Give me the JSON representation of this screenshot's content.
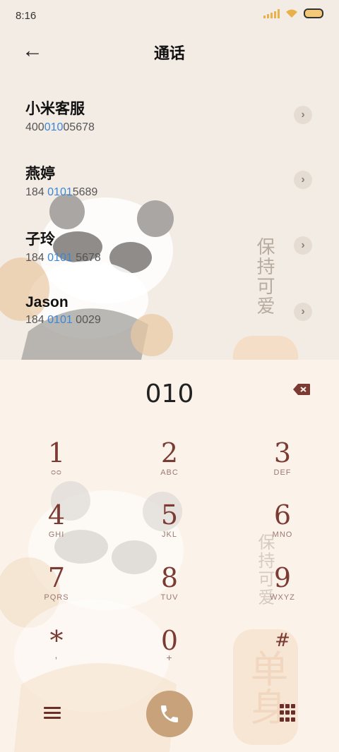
{
  "status": {
    "time": "8:16"
  },
  "header": {
    "title": "通话",
    "back_icon": "←"
  },
  "contacts": [
    {
      "name": "小米客服",
      "num_pre": "400",
      "num_hl": "010",
      "num_post": "05678"
    },
    {
      "name": "燕婷",
      "num_pre": "184 ",
      "num_hl": "0101",
      "num_post": "5689"
    },
    {
      "name": "子玲",
      "num_pre": "184 ",
      "num_hl": "0101",
      "num_post": " 5678"
    },
    {
      "name": "Jason",
      "num_pre": "184 ",
      "num_hl": "0101",
      "num_post": " 0029"
    }
  ],
  "decor": {
    "vertical_text": "保持可爱",
    "stamp_text": "单身"
  },
  "dialer": {
    "number": "010",
    "keys": [
      {
        "digit": "1",
        "sub": "ᴑᴑ"
      },
      {
        "digit": "2",
        "sub": "ABC"
      },
      {
        "digit": "3",
        "sub": "DEF"
      },
      {
        "digit": "4",
        "sub": "GHI"
      },
      {
        "digit": "5",
        "sub": "JKL"
      },
      {
        "digit": "6",
        "sub": "MNO"
      },
      {
        "digit": "7",
        "sub": "PQRS"
      },
      {
        "digit": "8",
        "sub": "TUV"
      },
      {
        "digit": "9",
        "sub": "WXYZ"
      },
      {
        "digit": "*",
        "sub": ","
      },
      {
        "digit": "0",
        "sub": "+"
      },
      {
        "digit": "#",
        "sub": ""
      }
    ]
  },
  "colors": {
    "accent_blue": "#3a86d8",
    "key_digit": "#7b3b33",
    "call_button": "#c8a27a"
  }
}
